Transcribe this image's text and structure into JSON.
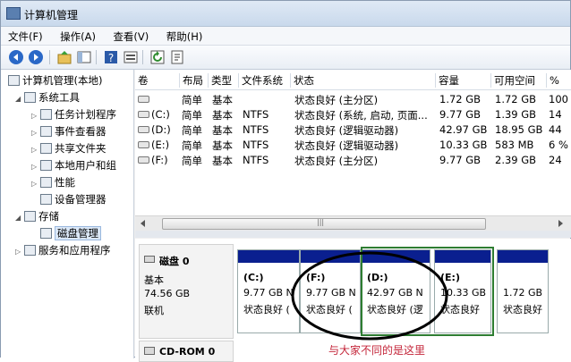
{
  "window": {
    "title": "计算机管理"
  },
  "menu": [
    "文件(F)",
    "操作(A)",
    "查看(V)",
    "帮助(H)"
  ],
  "toolbar": {
    "back_icon": "arrow-left-icon",
    "forward_icon": "arrow-right-icon",
    "up_icon": "folder-up-icon",
    "console_icon": "console-tree-icon",
    "help_icon": "help-icon",
    "properties_icon": "properties-icon",
    "refresh_icon": "refresh-icon",
    "export_icon": "export-icon"
  },
  "tree": {
    "root": "计算机管理(本地)",
    "items": [
      {
        "label": "系统工具"
      },
      {
        "label": "任务计划程序"
      },
      {
        "label": "事件查看器"
      },
      {
        "label": "共享文件夹"
      },
      {
        "label": "本地用户和组"
      },
      {
        "label": "性能"
      },
      {
        "label": "设备管理器"
      },
      {
        "label": "存储"
      },
      {
        "label": "磁盘管理"
      },
      {
        "label": "服务和应用程序"
      }
    ]
  },
  "list": {
    "headers": [
      "卷",
      "布局",
      "类型",
      "文件系统",
      "状态",
      "容量",
      "可用空间",
      "%"
    ],
    "rows": [
      {
        "vol": "",
        "layout": "简单",
        "type": "基本",
        "fs": "",
        "status": "状态良好 (主分区)",
        "cap": "1.72 GB",
        "free": "1.72 GB",
        "pct": "100"
      },
      {
        "vol": "(C:)",
        "layout": "简单",
        "type": "基本",
        "fs": "NTFS",
        "status": "状态良好 (系统, 启动, 页面...",
        "cap": "9.77 GB",
        "free": "1.39 GB",
        "pct": "14"
      },
      {
        "vol": "(D:)",
        "layout": "简单",
        "type": "基本",
        "fs": "NTFS",
        "status": "状态良好 (逻辑驱动器)",
        "cap": "42.97 GB",
        "free": "18.95 GB",
        "pct": "44"
      },
      {
        "vol": "(E:)",
        "layout": "简单",
        "type": "基本",
        "fs": "NTFS",
        "status": "状态良好 (逻辑驱动器)",
        "cap": "10.33 GB",
        "free": "583 MB",
        "pct": "6 %"
      },
      {
        "vol": "(F:)",
        "layout": "简单",
        "type": "基本",
        "fs": "NTFS",
        "status": "状态良好 (主分区)",
        "cap": "9.77 GB",
        "free": "2.39 GB",
        "pct": "24"
      }
    ],
    "scroll_glyph": "|||"
  },
  "disk": {
    "name": "磁盘 0",
    "type": "基本",
    "size": "74.56 GB",
    "status": "联机",
    "partitions": [
      {
        "name": "(C:)",
        "size": "9.77 GB N",
        "state": "状态良好 ("
      },
      {
        "name": "(F:)",
        "size": "9.77 GB N",
        "state": "状态良好 ("
      },
      {
        "name": "(D:)",
        "size": "42.97 GB N",
        "state": "状态良好 (逻"
      },
      {
        "name": "(E:)",
        "size": "10.33 GB",
        "state": "状态良好"
      },
      {
        "name": "",
        "size": "1.72 GB",
        "state": "状态良好"
      }
    ]
  },
  "cdrom": {
    "name": "CD-ROM 0"
  },
  "annotation": "与大家不同的是这里",
  "colors": {
    "partition_bar": "#0a1f8f",
    "annotation": "#c4263a",
    "highlight_box": "#2e7d32",
    "ellipse": "#000000"
  }
}
